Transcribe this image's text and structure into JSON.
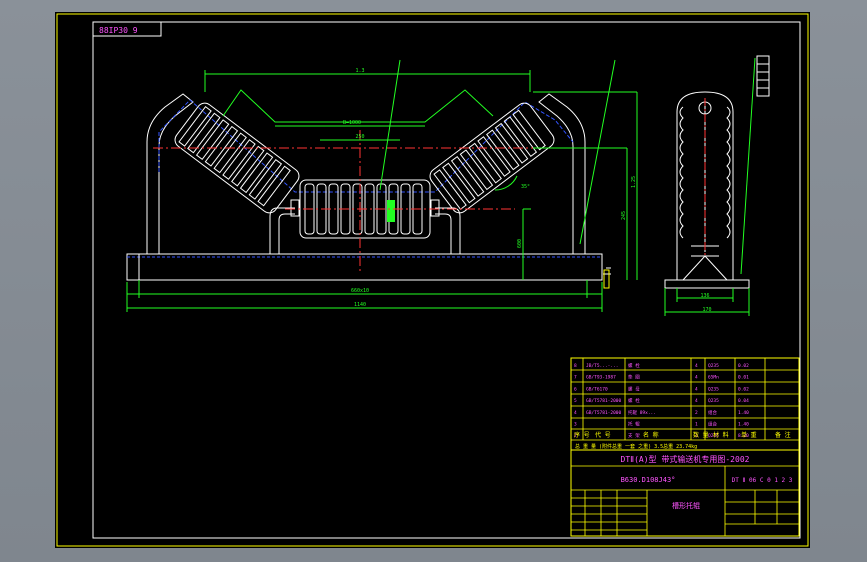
{
  "drawing": {
    "badge": "88IP30 9",
    "dims": {
      "d_top": "1.3",
      "d_mid": "B=1000",
      "d_center": "250",
      "d_overall": "600",
      "d_base_span": "660x10",
      "d_base": "1140",
      "d_right_h1": "1.25",
      "d_right_h2": "245",
      "d_side_w": "136",
      "d_side_base": "170",
      "angle": "35°"
    },
    "parts_table": {
      "rows": [
        {
          "no": "8",
          "code": "JB/T5...-...",
          "name": "螺 栓",
          "qty": "4",
          "mat": "Q235",
          "wt": "0.02"
        },
        {
          "no": "7",
          "code": "GB/T93-1987",
          "name": "垫 圈",
          "qty": "4",
          "mat": "65Mn",
          "wt": "0.01"
        },
        {
          "no": "6",
          "code": "GB/T6170",
          "name": "螺 母",
          "qty": "4",
          "mat": "Q235",
          "wt": "0.02"
        },
        {
          "no": "5",
          "code": "GB/T5781-2000",
          "name": "螺 栓",
          "qty": "4",
          "mat": "Q235",
          "wt": "0.04"
        },
        {
          "no": "4",
          "code": "GB/T5781-2000",
          "name": "托辊 89x...",
          "qty": "2",
          "mat": "组合",
          "wt": "1.40"
        },
        {
          "no": "3",
          "code": "",
          "name": "托 辊",
          "qty": "1",
          "mat": "组合",
          "wt": "1.40"
        },
        {
          "no": "2",
          "code": "",
          "name": "支 架",
          "qty": "1",
          "mat": "Q235",
          "wt": "8.20"
        }
      ],
      "header": [
        "序 号",
        "代 号",
        "名 称",
        "数 量",
        "材 料",
        "单 重",
        "备 注"
      ],
      "weight_line": "总 重 量 (附件总重 一套 之重) 3.5总重 23.74kg"
    },
    "title_block": {
      "series": "DTⅡ(A)型 带式输送机专用图-2002",
      "drawing_no": "DT Ⅱ 06 C 0 1 2 3",
      "drawing_code": "B630.D108J43°",
      "part_name": "槽形托辊"
    }
  }
}
